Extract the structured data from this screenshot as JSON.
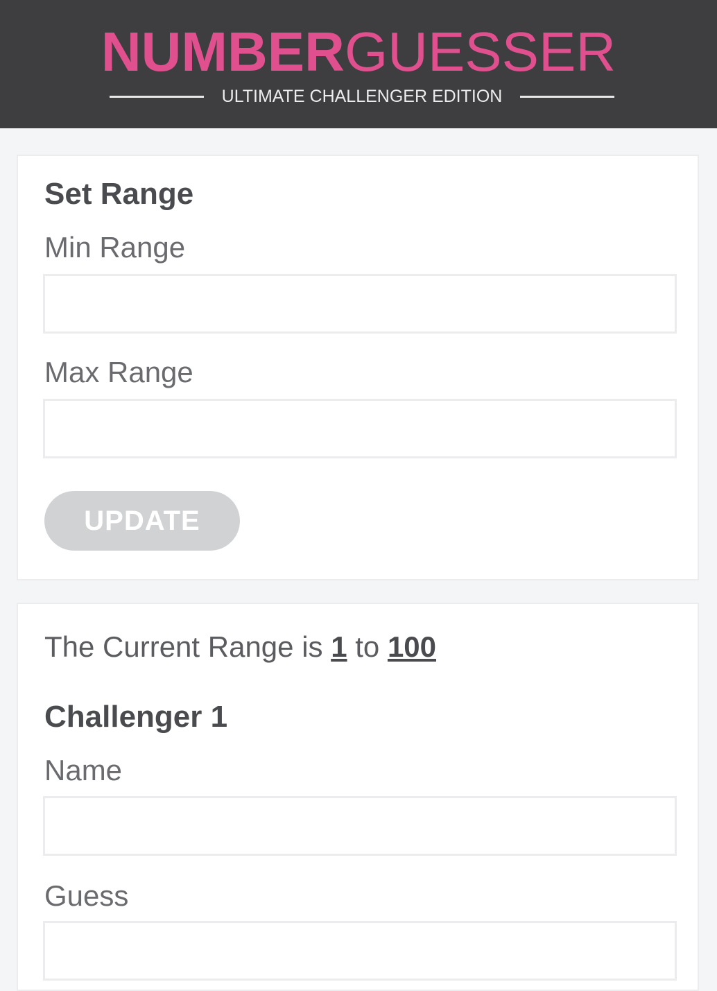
{
  "header": {
    "logo_bold": "NUMBER",
    "logo_light": "GUESSER",
    "subtitle": "ULTIMATE CHALLENGER EDITION"
  },
  "set_range": {
    "title": "Set Range",
    "min_label": "Min Range",
    "min_value": "",
    "max_label": "Max Range",
    "max_value": "",
    "update_label": "UPDATE"
  },
  "game": {
    "range_prefix": "The Current Range is",
    "range_min": "1",
    "range_mid": "to",
    "range_max": "100",
    "challenger_title": "Challenger 1",
    "name_label": "Name",
    "name_value": "",
    "guess_label": "Guess",
    "guess_value": ""
  },
  "colors": {
    "header_bg": "#3e3e40",
    "accent_pink": "#e0508e",
    "page_bg": "#f4f5f7",
    "button_disabled": "#d1d2d4"
  }
}
